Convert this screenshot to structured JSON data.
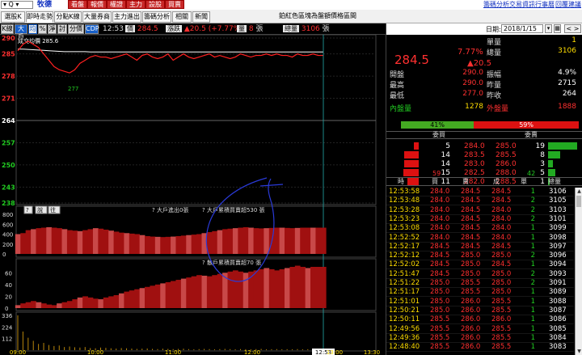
{
  "topbar": {
    "combo": "▾ Q ▾",
    "stock_name": "牧德",
    "menu_buttons": [
      "看盤",
      "報價",
      "權證",
      "主力",
      "設股",
      "買賣"
    ],
    "right_links": [
      "籌碼分析",
      "交易資訊",
      "行事曆",
      "回覆建議"
    ]
  },
  "tabs": {
    "items": [
      "選股K線",
      "即時走勢",
      "分點K線",
      "大量券商",
      "主力進出",
      "籌碼分析",
      "相關",
      "新聞"
    ],
    "active_index": 1,
    "banner": "鉑紅色區塊為盤額價格區間"
  },
  "chart_header": {
    "buttons": [
      "K線",
      "大戶",
      "均",
      "%",
      "淨",
      "討",
      "分價",
      "CDP"
    ],
    "time": "12:53",
    "price_label": "價",
    "price": "284.5",
    "change_label": "漲跌",
    "change": "▲20.5 (+7.77%)",
    "vol_label": "量",
    "vol": "8",
    "vol_unit": "張",
    "total_label": "總量",
    "total": "3106",
    "total_unit": "張"
  },
  "chart_data": {
    "type": "line",
    "price_axis": [
      290,
      285,
      278,
      271,
      264,
      257,
      250,
      243,
      238
    ],
    "price_axis_colors": [
      "#ff3030",
      "#ff3030",
      "#ff3030",
      "#ff3030",
      "#ffffff",
      "#22cc22",
      "#22cc22",
      "#22cc22",
      "#22cc22"
    ],
    "legend_avg": "成交均價 285.6",
    "low_mark": "277",
    "time_axis": [
      "09:00",
      "10:00",
      "11:00",
      "12:00",
      "12:53",
      "13:00",
      "13:30"
    ],
    "big_trader_axis": [
      800,
      600,
      400,
      200,
      0
    ],
    "big_trader_label_1": "大戶進出0張",
    "big_trader_label_2": "大戶累積買賣超530 張",
    "retail_axis": [
      60,
      40,
      20,
      0
    ],
    "retail_label": "散戶累積買賣超70 張",
    "volume_axis": [
      336,
      224,
      112
    ],
    "panel_buttons": [
      "?",
      "說",
      "往"
    ],
    "price_series": [
      286,
      288,
      289,
      288,
      287,
      285,
      283,
      281,
      280,
      279.5,
      279,
      280,
      282,
      283,
      284,
      284.5,
      284,
      284,
      283.5,
      284,
      284.5,
      285,
      284,
      283,
      284.5,
      285,
      284,
      283.5,
      284,
      285,
      283,
      284,
      285,
      284,
      283.5,
      284,
      284.5,
      285,
      284,
      284.5,
      284,
      283.5,
      284,
      285,
      284.5,
      284,
      284.5,
      284.5,
      285,
      284.5,
      285,
      284.5,
      284.5,
      284,
      285,
      284.5,
      284.5,
      285,
      284.5,
      284.5
    ],
    "avg_series": [
      286.5,
      286.5,
      286.4,
      286.3,
      286.2,
      286.1,
      286,
      285.9,
      285.8,
      285.7,
      285.7,
      285.7,
      285.7,
      285.7,
      285.6,
      285.6,
      285.6,
      285.6,
      285.6,
      285.6,
      285.6,
      285.6,
      285.6,
      285.6,
      285.6,
      285.6,
      285.6,
      285.6,
      285.6,
      285.6,
      285.6,
      285.6,
      285.6,
      285.6,
      285.6,
      285.6,
      285.6,
      285.6,
      285.6,
      285.6,
      285.6,
      285.6,
      285.6,
      285.6,
      285.6,
      285.6,
      285.6,
      285.6,
      285.6,
      285.6,
      285.6,
      285.6,
      285.6,
      285.6,
      285.6,
      285.6,
      285.6,
      285.6,
      285.6,
      285.6
    ],
    "big_series": [
      400,
      420,
      480,
      500,
      520,
      530,
      540,
      530,
      520,
      500,
      480,
      470,
      460,
      480,
      500,
      520,
      510,
      490,
      470,
      450,
      430,
      420,
      410,
      400,
      380,
      360,
      350,
      345,
      340,
      345,
      350,
      360,
      370,
      380,
      390,
      400,
      420,
      440,
      460,
      480,
      500,
      510,
      520,
      530,
      540,
      530,
      520,
      515,
      520,
      525,
      530,
      530,
      525,
      520,
      525,
      530,
      530,
      530,
      530,
      530
    ],
    "retail_series": [
      5,
      8,
      10,
      12,
      10,
      8,
      6,
      5,
      8,
      10,
      12,
      15,
      18,
      20,
      18,
      16,
      15,
      18,
      20,
      22,
      25,
      28,
      30,
      32,
      34,
      36,
      38,
      40,
      42,
      44,
      46,
      48,
      50,
      52,
      54,
      56,
      55,
      54,
      56,
      58,
      60,
      62,
      64,
      62,
      60,
      62,
      64,
      66,
      68,
      66,
      64,
      66,
      68,
      70,
      72,
      70,
      68,
      70,
      70,
      70
    ],
    "volume_series": [
      336,
      180,
      120,
      90,
      60,
      70,
      50,
      40,
      45,
      30,
      35,
      28,
      25,
      30,
      20,
      18,
      25,
      22,
      18,
      15,
      20,
      18,
      15,
      12,
      14,
      16,
      12,
      10,
      14,
      12,
      10,
      12,
      14,
      10,
      8,
      10,
      12,
      10,
      8,
      10,
      12,
      10,
      8,
      10,
      9,
      8,
      10,
      12,
      8,
      9,
      10,
      8,
      9,
      8,
      10,
      8,
      9,
      8,
      8,
      8
    ]
  },
  "panel": {
    "date_label": "日期:",
    "date": "2018/1/15",
    "go_label": "< >",
    "price": "284.5",
    "pct": "7.77%",
    "chg": "▲20.5",
    "fields": [
      {
        "label": "單量",
        "value": "1",
        "color": "#ffdd00"
      },
      {
        "label": "總量",
        "value": "3106",
        "color": "#ffdd00"
      },
      {
        "label": "開盤",
        "value": "290.0",
        "color": "#ff3030",
        "label2": "振幅",
        "value2": "4.9%",
        "color2": "#ffffff"
      },
      {
        "label": "最高",
        "value": "290.0",
        "color": "#ff3030",
        "label2": "昨量",
        "value2": "2715",
        "color2": "#ffffff"
      },
      {
        "label": "最低",
        "value": "277.0",
        "color": "#ff3030",
        "label2": "昨收",
        "value2": "264",
        "color2": "#ffffff"
      }
    ],
    "inner_label": "內盤量",
    "inner_value": "1278",
    "outer_label": "外盤量",
    "outer_value": "1888",
    "inner_pct": "41%",
    "outer_pct": "59%",
    "inner_ratio": 0.41,
    "book_hdr_bid": "委買",
    "book_hdr_ask": "委賣",
    "book": [
      {
        "bid_qty": "5",
        "bid": "284.0",
        "ask": "285.0",
        "ask_qty": "19",
        "bid_w": 0.2,
        "ask_w": 1.0
      },
      {
        "bid_qty": "14",
        "bid": "283.5",
        "ask": "285.5",
        "ask_qty": "8",
        "bid_w": 0.55,
        "ask_w": 0.42
      },
      {
        "bid_qty": "14",
        "bid": "283.0",
        "ask": "286.0",
        "ask_qty": "3",
        "bid_w": 0.55,
        "ask_w": 0.16
      },
      {
        "bid_qty": "15",
        "bid": "282.5",
        "ask": "288.0",
        "ask_qty": "5",
        "bid_w": 0.6,
        "ask_w": 0.26
      },
      {
        "bid_qty": "11",
        "bid": "282.0",
        "ask": "288.5",
        "ask_qty": "1",
        "bid_w": 0.45,
        "ask_w": 0.05
      }
    ],
    "book_total_bid": "59",
    "book_total_ask": "42",
    "tick_headers": [
      "時",
      "買",
      "賣",
      "成",
      "單",
      "總量"
    ],
    "ticks": [
      [
        "12:53:58",
        "284.0",
        "284.5",
        "284.5",
        "1",
        "3106"
      ],
      [
        "12:53:48",
        "284.0",
        "284.5",
        "284.5",
        "2",
        "3105"
      ],
      [
        "12:53:28",
        "284.0",
        "284.5",
        "284.0",
        "2",
        "3103"
      ],
      [
        "12:53:23",
        "284.0",
        "284.5",
        "284.0",
        "2",
        "3101"
      ],
      [
        "12:53:08",
        "284.0",
        "284.5",
        "284.0",
        "1",
        "3099"
      ],
      [
        "12:52:52",
        "284.0",
        "284.5",
        "284.0",
        "1",
        "3098"
      ],
      [
        "12:52:17",
        "284.5",
        "284.5",
        "284.5",
        "1",
        "3097"
      ],
      [
        "12:52:12",
        "284.5",
        "285.0",
        "285.0",
        "2",
        "3096"
      ],
      [
        "12:52:02",
        "284.5",
        "285.0",
        "284.5",
        "1",
        "3094"
      ],
      [
        "12:51:47",
        "284.5",
        "285.0",
        "285.0",
        "2",
        "3093"
      ],
      [
        "12:51:22",
        "285.0",
        "285.5",
        "285.0",
        "2",
        "3091"
      ],
      [
        "12:51:17",
        "285.0",
        "285.5",
        "285.0",
        "1",
        "3089"
      ],
      [
        "12:51:01",
        "285.0",
        "286.0",
        "285.5",
        "1",
        "3088"
      ],
      [
        "12:50:21",
        "285.0",
        "286.0",
        "285.5",
        "1",
        "3087"
      ],
      [
        "12:50:11",
        "285.5",
        "286.0",
        "286.0",
        "1",
        "3086"
      ],
      [
        "12:49:56",
        "285.5",
        "286.0",
        "285.5",
        "1",
        "3085"
      ],
      [
        "12:49:36",
        "285.5",
        "286.0",
        "285.5",
        "1",
        "3084"
      ],
      [
        "12:48:40",
        "285.5",
        "286.0",
        "285.5",
        "1",
        "3083"
      ]
    ]
  }
}
